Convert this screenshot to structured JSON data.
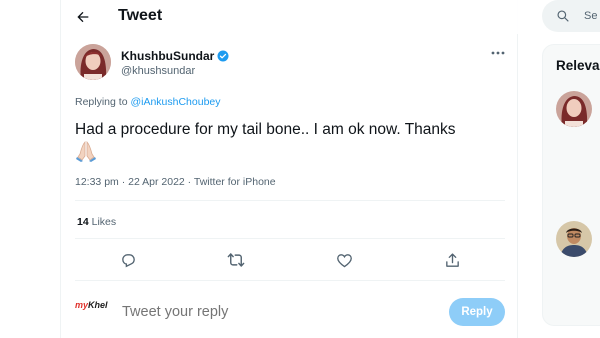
{
  "header": {
    "title": "Tweet",
    "back_icon": "arrow-left-icon"
  },
  "tweet": {
    "author_name": "KhushbuSundar",
    "author_handle": "@khushsundar",
    "verified_icon": "verified-badge-icon",
    "more_icon": "more-horizontal-icon",
    "replying_prefix": "Replying to",
    "replying_to": "@iAnkushChoubey",
    "text": "Had a procedure for my tail bone.. I am ok now. Thanks",
    "emoji": "praying-hands-emoji",
    "timestamp": "12:33 pm · 22 Apr 2022 · Twitter for iPhone",
    "likes_count": "14",
    "likes_label": "Likes",
    "actions": [
      "reply-icon",
      "retweet-icon",
      "like-icon",
      "share-icon"
    ]
  },
  "composer": {
    "logo_text_a": "my",
    "logo_text_b": "Khel",
    "placeholder": "Tweet your reply",
    "reply_button": "Reply"
  },
  "sidebar": {
    "search_placeholder": "Se",
    "panel_title": "Releva"
  },
  "colors": {
    "accent": "#1d9bf0",
    "reply_button_disabled": "#8ecdf8",
    "secondary_text": "#536471"
  }
}
